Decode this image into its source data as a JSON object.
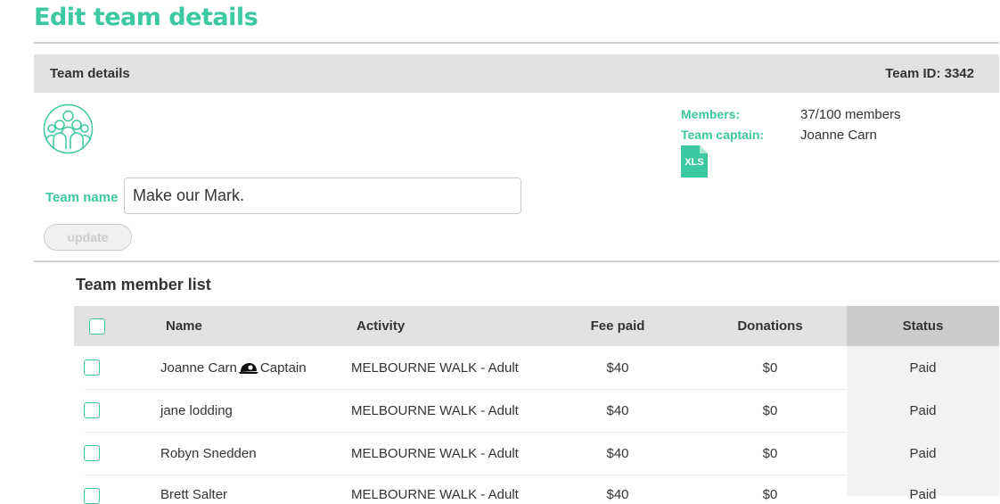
{
  "page": {
    "title": "Edit team details"
  },
  "details_bar": {
    "label": "Team details",
    "team_id": "Team ID: 3342"
  },
  "info": {
    "members_label": "Members:",
    "members_value": "37/100 members",
    "captain_label": "Team captain:",
    "captain_value": "Joanne Carn",
    "export_icon": "xls-file-icon",
    "export_icon_text": "XLS"
  },
  "team_name": {
    "label": "Team name",
    "value": "Make our Mark."
  },
  "update_button": {
    "label": "update"
  },
  "member_list": {
    "title": "Team member list",
    "columns": {
      "name": "Name",
      "activity": "Activity",
      "fee": "Fee paid",
      "donations": "Donations",
      "status": "Status"
    },
    "rows": [
      {
        "name": "Joanne Carn",
        "captain_icon": "captain-cap-icon",
        "role": "Captain",
        "activity": "MELBOURNE WALK - Adult",
        "fee": "$40",
        "donations": "$0",
        "status": "Paid"
      },
      {
        "name": "jane lodding",
        "activity": "MELBOURNE WALK - Adult",
        "fee": "$40",
        "donations": "$0",
        "status": "Paid"
      },
      {
        "name": "Robyn Snedden",
        "activity": "MELBOURNE WALK - Adult",
        "fee": "$40",
        "donations": "$0",
        "status": "Paid"
      },
      {
        "name": "Brett Salter",
        "activity": "MELBOURNE WALK - Adult",
        "fee": "$40",
        "donations": "$0",
        "status": "Paid"
      }
    ]
  },
  "colors": {
    "accent": "#3cc8a0",
    "header_bg": "#e2e2e2",
    "status_header_bg": "#cccccc",
    "status_column_bg": "#f2f2f2"
  }
}
